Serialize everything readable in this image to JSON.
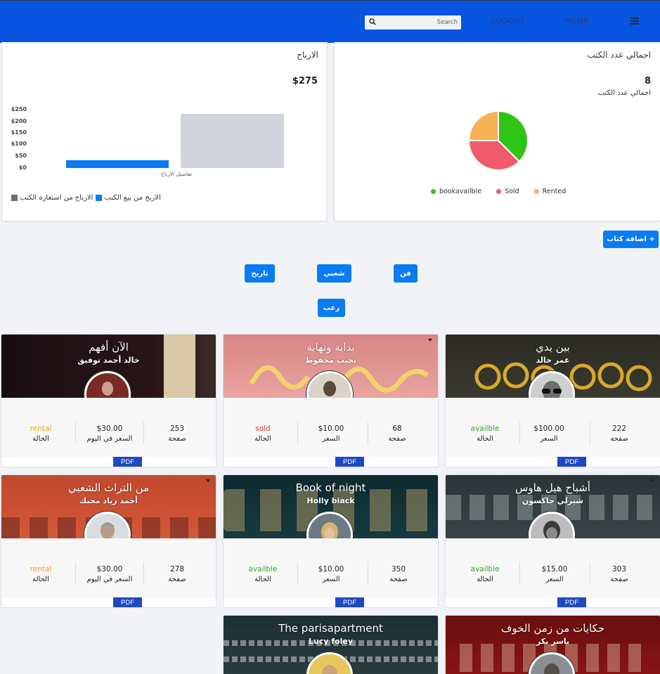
{
  "nav": {
    "search_placeholder": "Search",
    "logout": "LOGOUT",
    "home": "HOME"
  },
  "profits_card": {
    "title": "الارباح",
    "total": "$275",
    "chart_data": {
      "type": "bar",
      "orientation": "horizontal-layout",
      "categories": [
        "تفاصيل الارباح"
      ],
      "series": [
        {
          "name": "الاربح من بيع الكتب",
          "values": [
            35
          ],
          "color": "#0a7cf3"
        },
        {
          "name": "الارباح من استعارة الكتب",
          "values": [
            240
          ],
          "color": "#d1d5db"
        }
      ],
      "y_ticks": [
        "$250",
        "$200",
        "$150",
        "$100",
        "$50",
        "$0"
      ],
      "ylim": [
        0,
        250
      ],
      "legend_position": "bottom"
    },
    "legend": [
      {
        "label": "الاربح من بيع الكتب",
        "color": "#0a7cf3"
      },
      {
        "label": "الارباح من استعارة الكتب",
        "color": "#6b6f75"
      }
    ],
    "x_category_label": "تفاصيل الارباح"
  },
  "books_card": {
    "title": "اجمالي عدد الكتب",
    "total": "8",
    "subtitle": "اجمالي عدد الكتب",
    "chart_data": {
      "type": "pie",
      "labels": [
        "bookavailble",
        "Sold",
        "Rented"
      ],
      "values": [
        3,
        3,
        2
      ],
      "colors": [
        "#2ec416",
        "#f05a6b",
        "#f7b255"
      ],
      "legend_position": "bottom"
    }
  },
  "buttons": {
    "add_book": "+ اضافة كتاب",
    "categories": [
      "تاريخ",
      "شعبي",
      "فن",
      "رعب"
    ]
  },
  "books": [
    {
      "title": "بين يدي",
      "author": "عمر خالد",
      "pages": "222",
      "pages_label": "صفحة",
      "price": "$100.00",
      "price_label": "السعر",
      "status": "availble",
      "status_label": "الحالة",
      "pdf": "PDF"
    },
    {
      "title": "بداية ونهاية",
      "author": "نجيب محفوظ",
      "pages": "68",
      "pages_label": "صفحة",
      "price": "$10.00",
      "price_label": "السعر",
      "status": "sold",
      "status_label": "الحالة",
      "pdf": "PDF"
    },
    {
      "title": "الآن أفهم",
      "author": "خالد أحمد توفيق",
      "pages": "253",
      "pages_label": "صفحة",
      "price": "$30.00",
      "price_label": "السعر في اليوم",
      "status": "rental",
      "status_label": "الحالة",
      "pdf": "PDF"
    },
    {
      "title": "أشباح هيل هاوس",
      "author": "شيرلي جاكسون",
      "pages": "303",
      "pages_label": "صفحة",
      "price": "$15.00",
      "price_label": "السعر",
      "status": "availble",
      "status_label": "الحالة",
      "pdf": "PDF"
    },
    {
      "title": "Book of night",
      "author": "Holly biack",
      "pages": "350",
      "pages_label": "صفحة",
      "price": "$10.00",
      "price_label": "السعر",
      "status": "availble",
      "status_label": "الحالة",
      "pdf": "PDF"
    },
    {
      "title": "من التراث الشعبي",
      "author": "أحمد زياد محبك",
      "pages": "278",
      "pages_label": "صفحة",
      "price": "$30.00",
      "price_label": "السعر في اليوم",
      "status": "rental",
      "status_label": "الحالة",
      "pdf": "PDF"
    },
    {
      "title": "حكايات من زمن الخوف",
      "author": "ياسر بكر"
    },
    {
      "title": "The parisapartment",
      "author": "Lucy foley"
    }
  ],
  "colors": {
    "navbar": "#0755e0",
    "accent": "#0a7cf3",
    "pdf_button": "#1f49c4",
    "status_available": "#3aa33a",
    "status_sold": "#d33333",
    "status_rental": "#f0a020"
  }
}
